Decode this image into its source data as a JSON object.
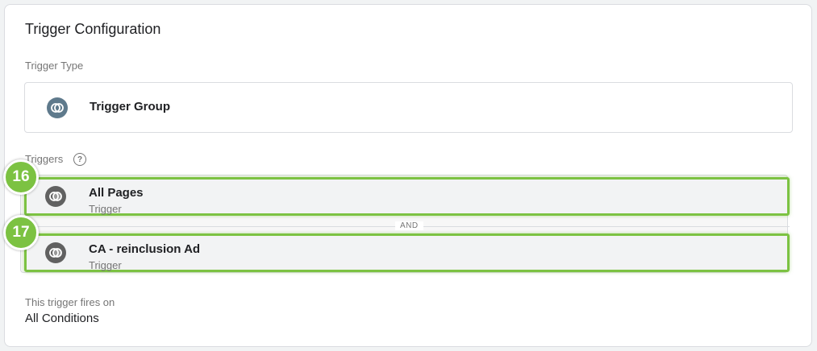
{
  "card": {
    "title": "Trigger Configuration",
    "trigger_type_label": "Trigger Type",
    "trigger_type_value": "Trigger Group",
    "triggers_label": "Triggers",
    "help_glyph": "?",
    "triggers": [
      {
        "name": "All Pages",
        "type": "Trigger",
        "badge": "16"
      },
      {
        "name": "CA - reinclusion Ad",
        "type": "Trigger",
        "badge": "17"
      }
    ],
    "and_label": "AND",
    "fires_on_label": "This trigger fires on",
    "fires_on_value": "All Conditions"
  },
  "colors": {
    "highlight": "#7cc242",
    "type_icon": "#5f7a8c",
    "trigger_icon": "#616161"
  },
  "icons": {
    "trigger_type": "trigger-group-icon",
    "trigger": "trigger-icon",
    "help": "help-icon"
  }
}
